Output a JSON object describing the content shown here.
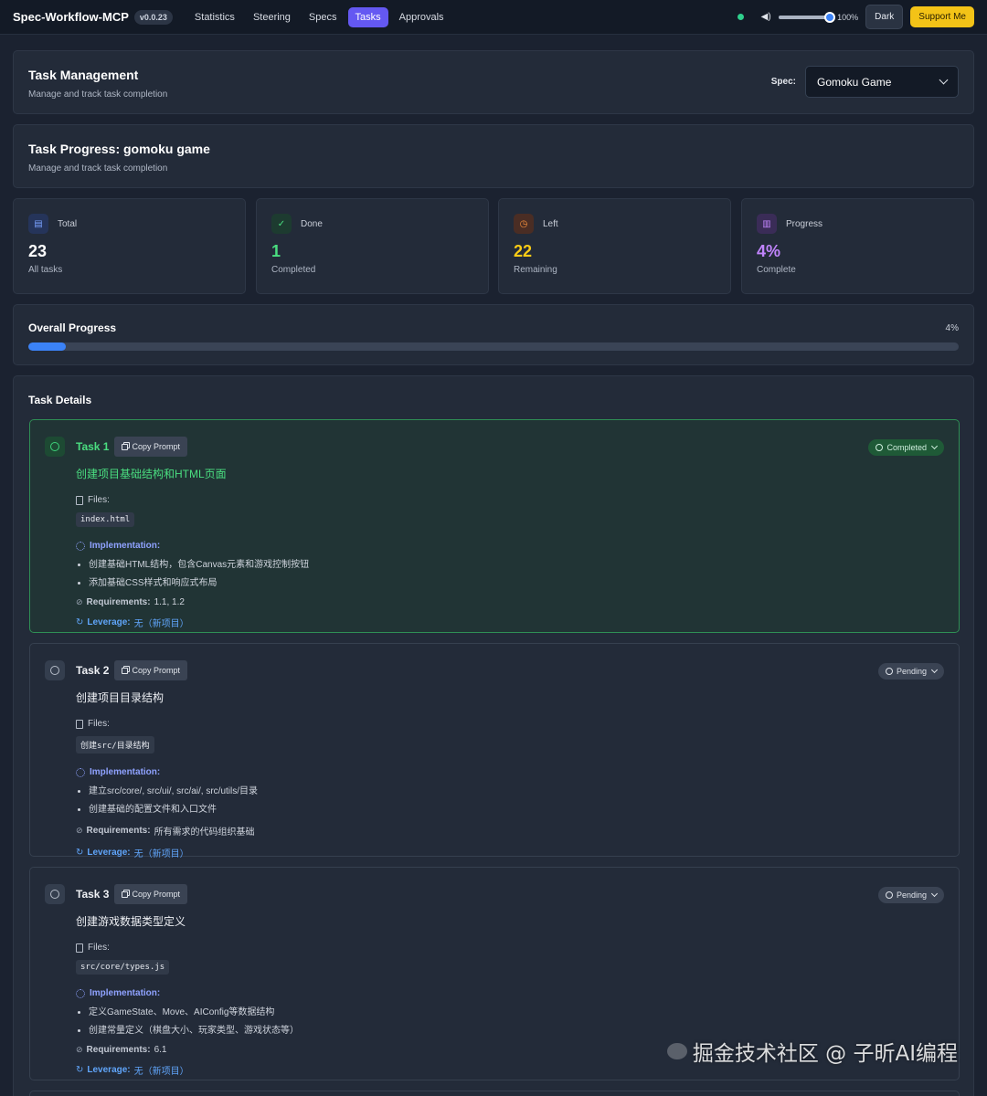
{
  "topbar": {
    "brand": "Spec-Workflow-MCP",
    "version": "v0.0.23",
    "nav": [
      "Statistics",
      "Steering",
      "Specs",
      "Tasks",
      "Approvals"
    ],
    "active_nav": "Tasks",
    "volume": "100%",
    "volume_fraction": 1.0,
    "theme": "Dark",
    "support": "Support Me"
  },
  "header": {
    "title": "Task Management",
    "subtitle": "Manage and track task completion",
    "spec_label": "Spec:",
    "spec_value": "Gomoku Game"
  },
  "progress_header": {
    "title": "Task Progress: gomoku game",
    "subtitle": "Manage and track task completion"
  },
  "stats": [
    {
      "label": "Total",
      "value": "23",
      "caption": "All tasks",
      "color": "#ffffff",
      "icon": "clipboard-icon"
    },
    {
      "label": "Done",
      "value": "1",
      "caption": "Completed",
      "color": "#4ade80",
      "icon": "check-circle-icon"
    },
    {
      "label": "Left",
      "value": "22",
      "caption": "Remaining",
      "color": "#facc15",
      "icon": "clock-icon"
    },
    {
      "label": "Progress",
      "value": "4%",
      "caption": "Complete",
      "color": "#c084fc",
      "icon": "bar-chart-icon"
    }
  ],
  "overall": {
    "title": "Overall Progress",
    "percent_label": "4%",
    "fraction": 0.04
  },
  "task_details": {
    "title": "Task Details",
    "copy_label": "Copy Prompt",
    "files_label": "Files:",
    "impl_label": "Implementation:",
    "req_label": "Requirements:",
    "lev_label": "Leverage:",
    "tasks": [
      {
        "name": "Task 1",
        "status": "Completed",
        "desc": "创建项目基础结构和HTML页面",
        "file": "index.html",
        "impl": [
          "创建基础HTML结构，包含Canvas元素和游戏控制按钮",
          "添加基础CSS样式和响应式布局"
        ],
        "requirements": "1.1, 1.2",
        "leverage": "无（新项目）"
      },
      {
        "name": "Task 2",
        "status": "Pending",
        "desc": "创建项目目录结构",
        "file": "创建src/目录结构",
        "impl": [
          "建立src/core/, src/ui/, src/ai/, src/utils/目录",
          "创建基础的配置文件和入口文件"
        ],
        "requirements": "所有需求的代码组织基础",
        "leverage": "无（新项目）"
      },
      {
        "name": "Task 3",
        "status": "Pending",
        "desc": "创建游戏数据类型定义",
        "file": "src/core/types.js",
        "impl": [
          "定义GameState、Move、AIConfig等数据结构",
          "创建常量定义（棋盘大小、玩家类型、游戏状态等）"
        ],
        "requirements": "6.1",
        "leverage": "无（新项目）"
      }
    ]
  },
  "watermark": "掘金技术社区 @ 子昕AI编程"
}
